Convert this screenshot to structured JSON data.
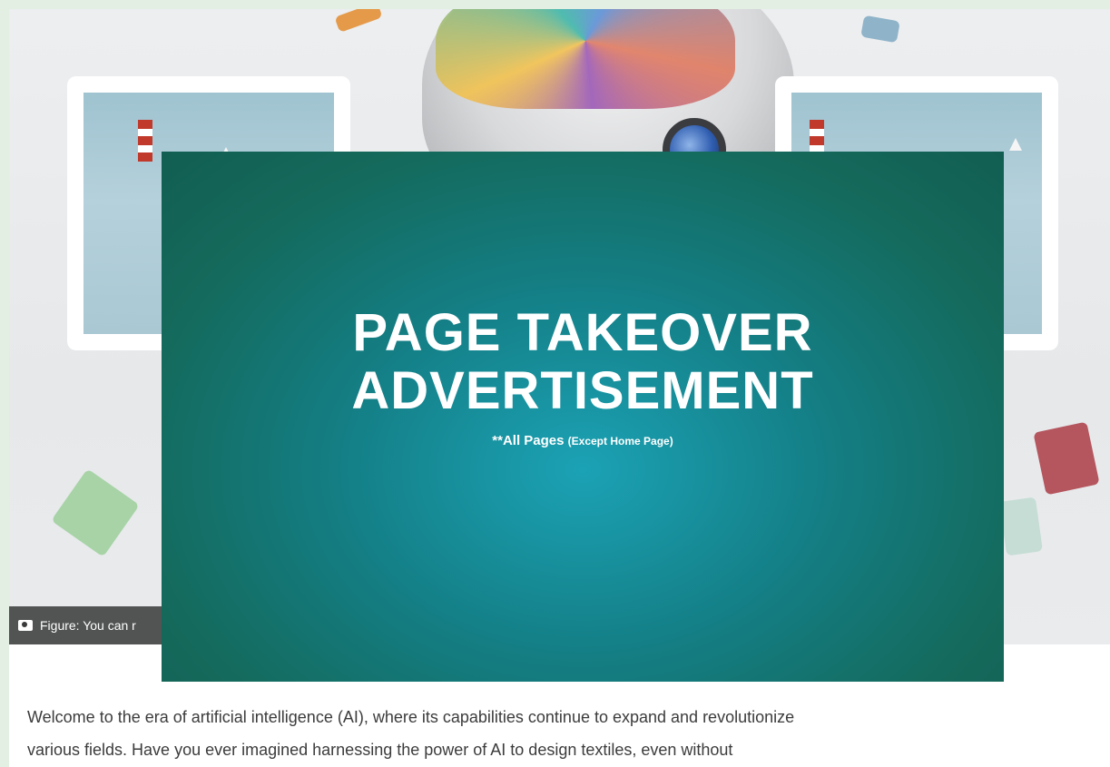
{
  "hero": {
    "caption": "Figure: You can r"
  },
  "ad": {
    "title_line1": "PAGE  TAKEOVER",
    "title_line2": "ADVERTISEMENT",
    "subtitle_main": "**All Pages ",
    "subtitle_paren": "(Except Home Page)",
    "bg_color_center": "#1ba2b5",
    "bg_color_edge": "#125e52"
  },
  "article": {
    "paragraph_line1": "Welcome to the era of artificial intelligence (AI), where its capabilities continue to expand and revolutionize",
    "paragraph_line2": "various fields. Have you ever imagined harnessing the power of AI to design textiles, even without"
  }
}
